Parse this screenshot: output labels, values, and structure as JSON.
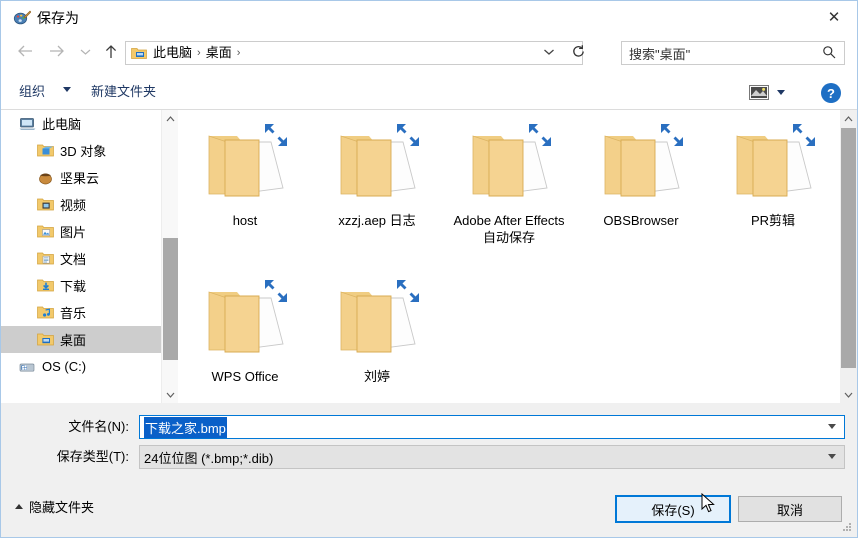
{
  "window": {
    "title": "保存为",
    "title_icon": "paint-app-icon",
    "close_label": "✕"
  },
  "nav": {
    "back_icon": "arrow-left-icon",
    "forward_icon": "arrow-right-icon",
    "recent_icon": "chevron-down-icon",
    "up_icon": "arrow-up-icon",
    "refresh_icon": "refresh-icon",
    "address_dropdown_icon": "chevron-down-icon",
    "breadcrumbs": [
      "此电脑",
      "桌面"
    ],
    "breadcrumb_separator": "›",
    "folder_icon": "desktop-folder-icon"
  },
  "search": {
    "placeholder": "搜索\"桌面\"",
    "icon": "search-icon"
  },
  "command_bar": {
    "organize_label": "组织",
    "organize_caret_icon": "caret-down-icon",
    "new_folder_label": "新建文件夹",
    "view_icon": "view-mode-icon",
    "view_caret_icon": "caret-down-icon",
    "help_icon": "help-icon",
    "help_label": "?"
  },
  "sidebar": {
    "items": [
      {
        "label": "此电脑",
        "icon": "this-pc-icon",
        "level": "root",
        "selected": false
      },
      {
        "label": "3D 对象",
        "icon": "folder-3d-icon",
        "level": "child",
        "selected": false
      },
      {
        "label": "坚果云",
        "icon": "nutstore-icon",
        "level": "child",
        "selected": false
      },
      {
        "label": "视频",
        "icon": "videos-icon",
        "level": "child",
        "selected": false
      },
      {
        "label": "图片",
        "icon": "pictures-icon",
        "level": "child",
        "selected": false
      },
      {
        "label": "文档",
        "icon": "documents-icon",
        "level": "child",
        "selected": false
      },
      {
        "label": "下载",
        "icon": "downloads-icon",
        "level": "child",
        "selected": false
      },
      {
        "label": "音乐",
        "icon": "music-icon",
        "level": "child",
        "selected": false
      },
      {
        "label": "桌面",
        "icon": "desktop-icon",
        "level": "child",
        "selected": true
      },
      {
        "label": "OS (C:)",
        "icon": "drive-icon",
        "level": "root",
        "selected": false
      }
    ],
    "scrollbar": {
      "up_icon": "chevron-up-icon",
      "down_icon": "chevron-down-icon"
    }
  },
  "files": {
    "items": [
      {
        "label": "host",
        "icon": "folder-icon",
        "badge": "sync-arrows-icon"
      },
      {
        "label": "xzzj.aep 日志",
        "icon": "folder-icon",
        "badge": "sync-arrows-icon"
      },
      {
        "label": "Adobe After Effects 自动保存",
        "icon": "folder-icon",
        "badge": "sync-arrows-icon"
      },
      {
        "label": "OBSBrowser",
        "icon": "folder-icon",
        "badge": "sync-arrows-icon"
      },
      {
        "label": "PR剪辑",
        "icon": "folder-icon",
        "badge": "sync-arrows-icon"
      },
      {
        "label": "WPS Office",
        "icon": "folder-icon",
        "badge": "sync-arrows-icon"
      },
      {
        "label": "刘婷",
        "icon": "folder-icon",
        "badge": "sync-arrows-icon"
      }
    ],
    "scrollbar": {
      "up_icon": "chevron-up-icon",
      "down_icon": "chevron-down-icon"
    }
  },
  "fields": {
    "filename_label": "文件名(N):",
    "filename_value": "下载之家.bmp",
    "filetype_label": "保存类型(T):",
    "filetype_value": "24位位图 (*.bmp;*.dib)",
    "dropdown_icon": "caret-down-icon"
  },
  "footer": {
    "hide_folders_label": "隐藏文件夹",
    "hide_folders_icon": "caret-up-icon",
    "save_label": "保存(S)",
    "cancel_label": "取消",
    "cursor_icon": "mouse-pointer-icon",
    "resize_grip_icon": "resize-grip-icon"
  },
  "colors": {
    "accent": "#0078d7",
    "selection": "#0a60c8",
    "sidebar_selected": "#cdcdcd",
    "folder": "#f5d58a",
    "badge_blue": "#2a6fc0",
    "link_text": "#1f3864"
  }
}
